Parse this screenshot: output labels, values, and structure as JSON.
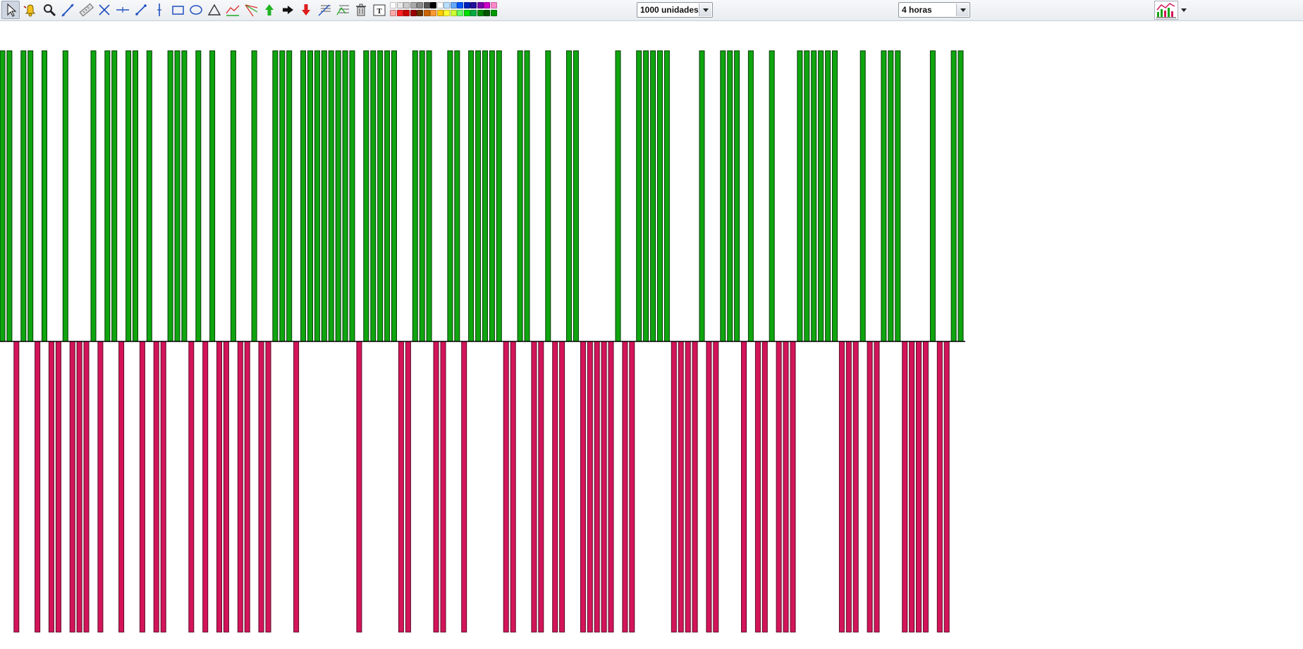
{
  "toolbar": {
    "tools": [
      {
        "name": "pointer-icon",
        "active": true
      },
      {
        "name": "alert-bell-icon",
        "active": false
      },
      {
        "name": "zoom-icon",
        "active": false
      },
      {
        "name": "trend-line-icon",
        "active": false
      },
      {
        "name": "ruler-icon",
        "active": false
      },
      {
        "name": "ray-line-icon",
        "active": false
      },
      {
        "name": "horizontal-line-icon",
        "active": false
      },
      {
        "name": "segment-line-icon",
        "active": false
      },
      {
        "name": "vertical-line-icon",
        "active": false
      },
      {
        "name": "rectangle-icon",
        "active": false
      },
      {
        "name": "ellipse-icon",
        "active": false
      },
      {
        "name": "triangle-icon",
        "active": false
      },
      {
        "name": "channel-icon",
        "active": false
      },
      {
        "name": "fan-icon",
        "active": false
      },
      {
        "name": "arrow-up-icon",
        "active": false
      },
      {
        "name": "arrow-right-icon",
        "active": false
      },
      {
        "name": "arrow-down-icon",
        "active": false
      },
      {
        "name": "fibonacci-icon",
        "active": false
      },
      {
        "name": "fibonacci-extension-icon",
        "active": false
      },
      {
        "name": "trash-icon",
        "active": false
      },
      {
        "name": "text-tool-icon",
        "active": false
      }
    ],
    "palette": {
      "top": [
        "#ffffff",
        "#e8e8e8",
        "#cccccc",
        "#aaaaaa",
        "#888888",
        "#555555",
        "#000000",
        "#ffffff",
        "#bbe0ff",
        "#66aaff",
        "#0055ff",
        "#0022bb",
        "#221199",
        "#7700aa",
        "#cc00cc",
        "#ff88cc"
      ],
      "bottom": [
        "#ffaaaa",
        "#ff2222",
        "#cc0000",
        "#990000",
        "#663300",
        "#cc6600",
        "#ff9933",
        "#ffcc00",
        "#ffff33",
        "#ccff33",
        "#66ff66",
        "#00dd00",
        "#00aa44",
        "#008800",
        "#005500",
        "#009900"
      ]
    },
    "units_select": "1000 unidades",
    "period_select": "4 horas",
    "chart_type_icon": "chart-type-icon"
  },
  "colors": {
    "up_fill": "#0fa50f",
    "up_stroke": "#063a06",
    "down_fill": "#d4145a",
    "down_stroke": "#5a0a24",
    "baseline": "#000000"
  },
  "chart_data": {
    "type": "bar",
    "directions": [
      1,
      1,
      -1,
      1,
      1,
      -1,
      1,
      -1,
      -1,
      1,
      -1,
      -1,
      -1,
      1,
      -1,
      1,
      1,
      -1,
      1,
      1,
      -1,
      1,
      -1,
      -1,
      1,
      1,
      1,
      -1,
      1,
      -1,
      1,
      -1,
      -1,
      1,
      -1,
      -1,
      1,
      -1,
      -1,
      1,
      1,
      1,
      -1,
      1,
      1,
      1,
      1,
      1,
      1,
      1,
      1,
      -1,
      1,
      1,
      1,
      1,
      1,
      -1,
      -1,
      1,
      1,
      1,
      -1,
      -1,
      1,
      1,
      -1,
      1,
      1,
      1,
      1,
      1,
      -1,
      -1,
      1,
      1,
      -1,
      -1,
      1,
      -1,
      -1,
      1,
      1,
      -1,
      -1,
      -1,
      -1,
      -1,
      1,
      -1,
      -1,
      1,
      1,
      1,
      1,
      1,
      -1,
      -1,
      -1,
      -1,
      1,
      -1,
      -1,
      1,
      1,
      1,
      -1,
      1,
      -1,
      -1,
      1,
      -1,
      -1,
      -1,
      1,
      1,
      1,
      1,
      1,
      1,
      -1,
      -1,
      -1,
      1,
      -1,
      -1,
      1,
      1,
      1,
      -1,
      -1,
      -1,
      -1,
      1,
      -1,
      -1,
      1,
      1
    ],
    "grid": false
  }
}
